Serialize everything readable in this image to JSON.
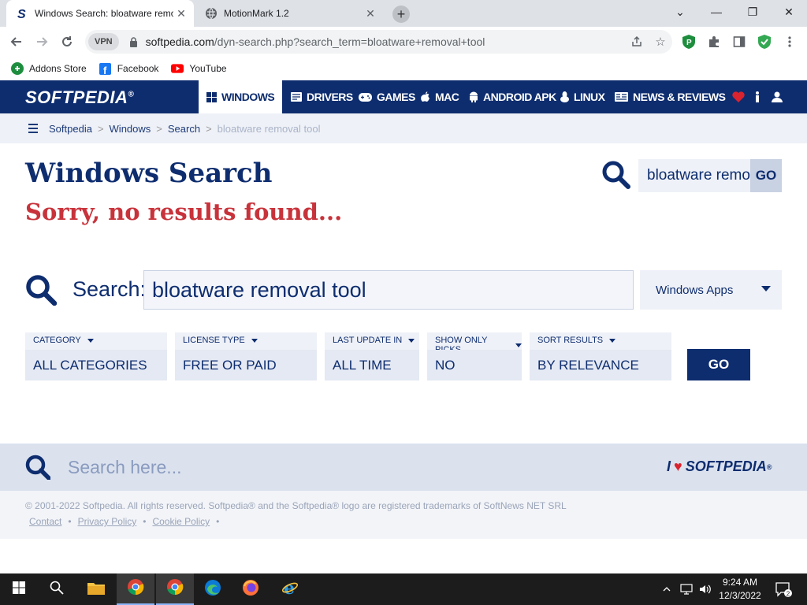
{
  "browser": {
    "tabs": [
      {
        "title": "Windows Search: bloatware removal tool",
        "active": true
      },
      {
        "title": "MotionMark 1.2",
        "active": false
      }
    ],
    "new_tab": "+",
    "window_controls": {
      "dropdown": "⌄",
      "minimize": "—",
      "maximize": "❐",
      "close": "✕"
    },
    "vpn_label": "VPN",
    "url_host": "softpedia.com",
    "url_path": "/dyn-search.php?search_term=bloatware+removal+tool",
    "bookmarks": [
      {
        "label": "Addons Store",
        "icon": "addons-store-icon"
      },
      {
        "label": "Facebook",
        "icon": "facebook-icon"
      },
      {
        "label": "YouTube",
        "icon": "youtube-icon"
      }
    ]
  },
  "site": {
    "logo": "SOFTPEDIA",
    "logo_mark": "®",
    "nav": [
      {
        "label": "WINDOWS",
        "icon": "windows-icon",
        "selected": true
      },
      {
        "label": "DRIVERS",
        "icon": "drivers-icon",
        "selected": false
      },
      {
        "label": "GAMES",
        "icon": "gamepad-icon",
        "selected": false
      },
      {
        "label": "MAC",
        "icon": "apple-icon",
        "selected": false
      },
      {
        "label": "ANDROID APK",
        "icon": "android-icon",
        "selected": false
      },
      {
        "label": "LINUX",
        "icon": "linux-icon",
        "selected": false
      },
      {
        "label": "NEWS & REVIEWS",
        "icon": "news-icon",
        "selected": false
      }
    ],
    "breadcrumb": [
      "Softpedia",
      "Windows",
      "Search",
      "bloatware removal tool"
    ],
    "breadcrumb_sep": ">",
    "title": "Windows Search",
    "subtitle": "Sorry, no results found...",
    "top_search_value": "bloatware removal tool",
    "go_label": "GO",
    "search_label": "Search:",
    "search_value": "bloatware removal tool",
    "scope": "Windows Apps",
    "filters": [
      {
        "label": "CATEGORY",
        "value": "ALL CATEGORIES"
      },
      {
        "label": "LICENSE TYPE",
        "value": "FREE OR PAID"
      },
      {
        "label": "LAST UPDATE IN",
        "value": "ALL TIME"
      },
      {
        "label": "SHOW ONLY PICKS",
        "value": "NO"
      },
      {
        "label": "SORT RESULTS",
        "value": "BY RELEVANCE"
      }
    ],
    "filter_go": "GO",
    "footer_search_placeholder": "Search here...",
    "love_prefix": "I",
    "love_heart": "♥",
    "love_brand": "SOFTPEDIA",
    "copyright": "© 2001-2022 Softpedia. All rights reserved. Softpedia® and the Softpedia® logo are registered trademarks of SoftNews NET SRL",
    "footer_links": [
      "Contact",
      "Privacy Policy",
      "Cookie Policy"
    ],
    "footer_sep": "•"
  },
  "taskbar": {
    "time": "9:24 AM",
    "date": "12/3/2022",
    "notification_count": "2"
  },
  "colors": {
    "brand_navy": "#0e2d6f",
    "error_red": "#c8333b",
    "heart_red": "#d9232e"
  }
}
